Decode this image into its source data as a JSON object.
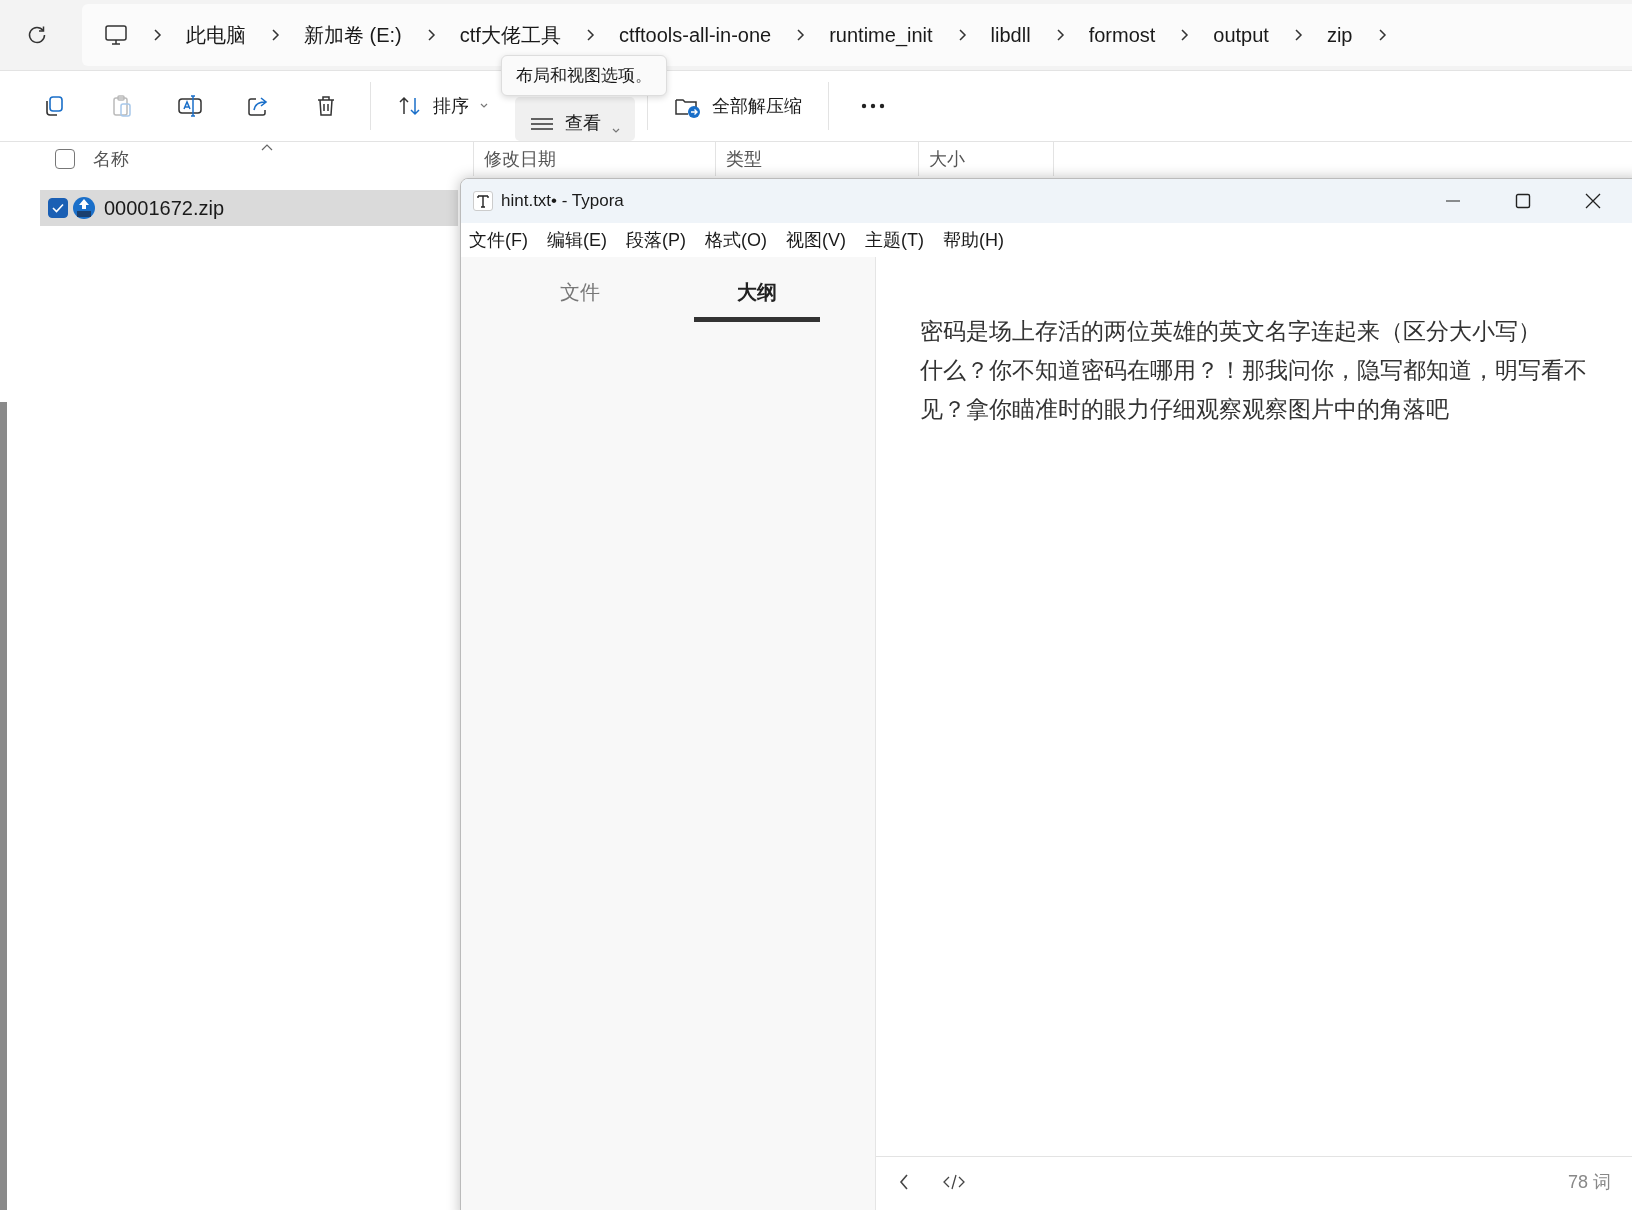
{
  "explorer": {
    "breadcrumbs": [
      "此电脑",
      "新加卷 (E:)",
      "ctf大佬工具",
      "ctftools-all-in-one",
      "runtime_init",
      "libdll",
      "formost",
      "output",
      "zip"
    ],
    "toolbar": {
      "paste_disabled": true,
      "sort_button": "排序",
      "view_button": "查看",
      "extract_button": "全部解压缩"
    },
    "tooltip": "布局和视图选项。",
    "select_all_checked": false,
    "columns": [
      "名称",
      "修改日期",
      "类型",
      "大小"
    ],
    "files": [
      {
        "name": "00001672.zip",
        "selected": true,
        "checked": true
      }
    ]
  },
  "typora": {
    "title": "hint.txt• - Typora",
    "menu": [
      "文件(F)",
      "编辑(E)",
      "段落(P)",
      "格式(O)",
      "视图(V)",
      "主题(T)",
      "帮助(H)"
    ],
    "sidebar_tabs": [
      {
        "label": "文件",
        "selected": false
      },
      {
        "label": "大纲",
        "selected": true
      }
    ],
    "lines": [
      "密码是场上存活的两位英雄的英文名字连起来（区分大小写）",
      "什么？你不知道密码在哪用？！那我问你，隐写都知道，明写看不见？拿你瞄准时的眼力仔细观察观察图片中的角落吧"
    ],
    "word_count": "78 词"
  }
}
